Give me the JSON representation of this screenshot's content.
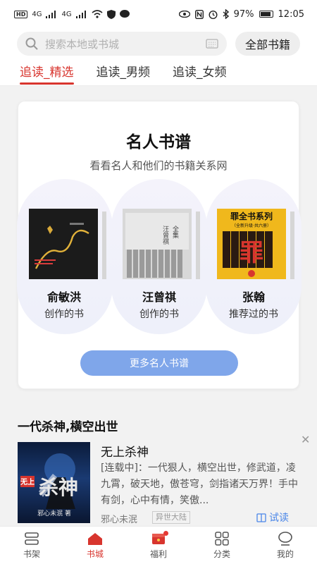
{
  "status_bar": {
    "left_chips": [
      "HD",
      "4G",
      "4G"
    ],
    "battery": "97%",
    "time": "12:05"
  },
  "search": {
    "placeholder": "搜索本地或书城",
    "all_books_label": "全部书籍"
  },
  "tabs": [
    {
      "label": "追读_精选",
      "active": true
    },
    {
      "label": "追读_男频",
      "active": false
    },
    {
      "label": "追读_女频",
      "active": false
    }
  ],
  "celebrity": {
    "title": "名人书谱",
    "subtitle": "看看名人和他们的书籍关系网",
    "people": [
      {
        "name": "俞敏洪",
        "role": "创作的书"
      },
      {
        "name": "汪曾祺",
        "role": "创作的书"
      },
      {
        "name": "张翰",
        "role": "推荐过的书"
      }
    ],
    "more_button": "更多名人书谱",
    "covers": {
      "third_title": "罪全书系列",
      "third_sub": "（全新升级·共六册）",
      "third_big": "罪",
      "second_title": "汪曾祺全集"
    }
  },
  "section": {
    "title": "一代杀神,横空出世"
  },
  "book": {
    "title": "无上杀神",
    "description": "[连载中]：一代狠人，横空出世，修武道，凌九霄，破天地，傲苍穹，剑指诸天万界！手中有剑，心中有情，笑傲...",
    "author": "邪心未泯",
    "tag": "异世大陆",
    "try_read": "试读",
    "cover_text_top": "无上",
    "cover_text_big": "杀神",
    "cover_author": "邪心未泯 著"
  },
  "bottom_nav": [
    {
      "label": "书架",
      "icon": "bookshelf-icon",
      "active": false
    },
    {
      "label": "书城",
      "icon": "bookstore-icon",
      "active": true
    },
    {
      "label": "福利",
      "icon": "gift-icon",
      "active": false
    },
    {
      "label": "分类",
      "icon": "category-icon",
      "active": false
    },
    {
      "label": "我的",
      "icon": "profile-icon",
      "active": false
    }
  ],
  "colors": {
    "accent": "#d8352e",
    "button_blue": "#7fa6ea",
    "link_blue": "#4a86e8"
  }
}
